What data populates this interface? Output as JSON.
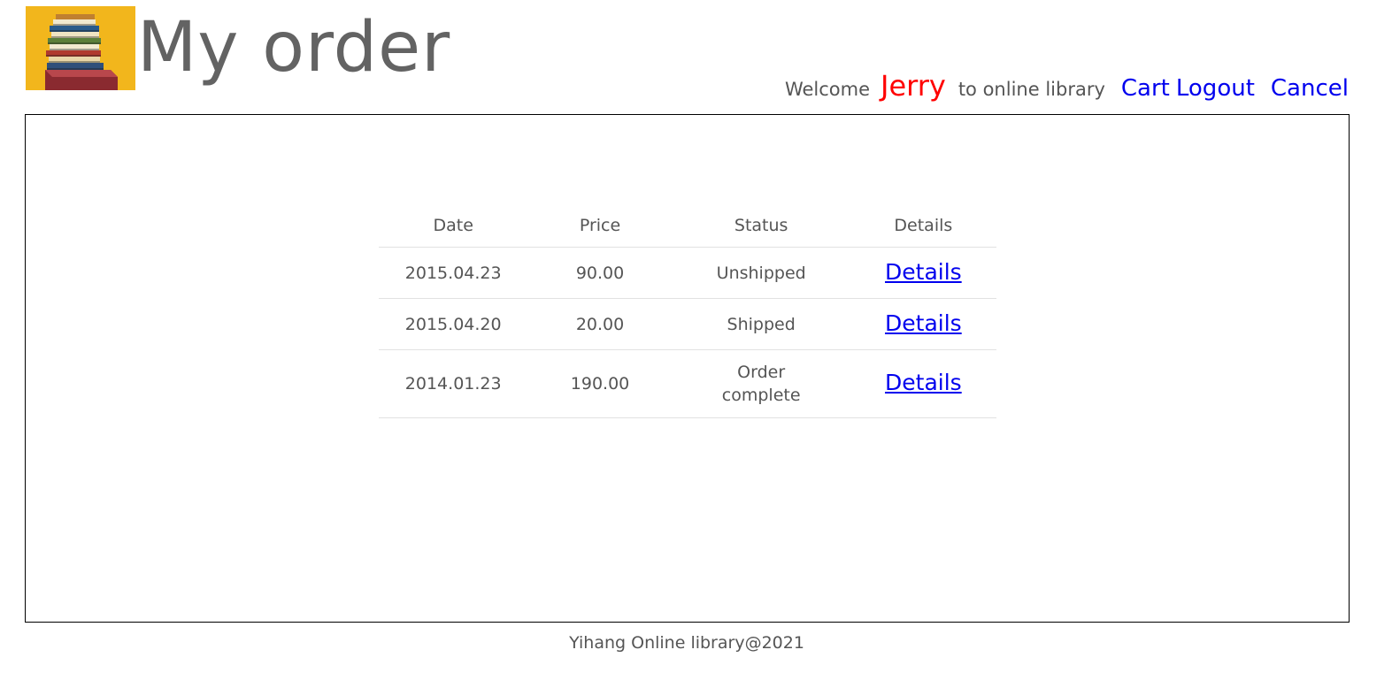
{
  "header": {
    "title": "My order",
    "logo_icon": "books-stack-icon",
    "welcome_prefix": "Welcome",
    "username": "Jerry",
    "welcome_suffix": "to online library",
    "nav": {
      "cart": "Cart",
      "logout": "Logout",
      "cancel": "Cancel"
    }
  },
  "orders": {
    "columns": [
      "Date",
      "Price",
      "Status",
      "Details"
    ],
    "rows": [
      {
        "date": "2015.04.23",
        "price": "90.00",
        "status": "Unshipped",
        "details": "Details"
      },
      {
        "date": "2015.04.20",
        "price": "20.00",
        "status": "Shipped",
        "details": "Details"
      },
      {
        "date": "2014.01.23",
        "price": "190.00",
        "status": "Order complete",
        "details": "Details"
      }
    ]
  },
  "footer": {
    "text": "Yihang Online library@2021"
  },
  "colors": {
    "link": "#0000ee",
    "username": "#ff0000",
    "logo_background": "#f2b61c",
    "text": "#555555"
  }
}
